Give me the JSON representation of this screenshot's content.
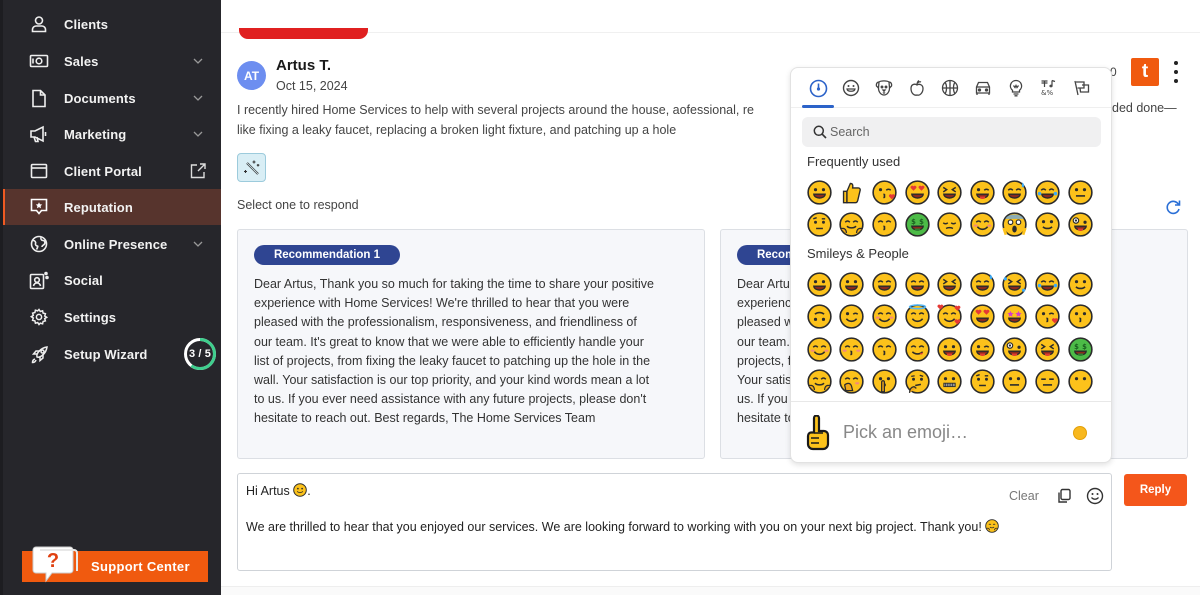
{
  "sidebar": {
    "items": [
      {
        "label": "Clients",
        "icon": "person-icon",
        "chevron": false
      },
      {
        "label": "Sales",
        "icon": "cash-icon",
        "chevron": true
      },
      {
        "label": "Documents",
        "icon": "document-icon",
        "chevron": true
      },
      {
        "label": "Marketing",
        "icon": "megaphone-icon",
        "chevron": true
      },
      {
        "label": "Client Portal",
        "icon": "browser-window-icon",
        "external": true
      },
      {
        "label": "Reputation",
        "icon": "star-chat-icon",
        "active": true
      },
      {
        "label": "Online Presence",
        "icon": "globe-icon",
        "chevron": true
      },
      {
        "label": "Social",
        "icon": "social-icon",
        "chevron": false
      },
      {
        "label": "Settings",
        "icon": "gear-icon",
        "chevron": false
      },
      {
        "label": "Setup Wizard",
        "icon": "rocket-icon",
        "progress_label": "3 / 5",
        "progress": 0.6
      }
    ],
    "support_label": "Support Center"
  },
  "review": {
    "avatar_initials": "AT",
    "author": "Artus T.",
    "date": "Oct 15, 2024",
    "text_line1": "I recently hired Home Services to help with several projects around the house, a",
    "text_line1_b": "ofessional, re",
    "text_line1_tail": "ded done—",
    "text_line2": "like fixing a leaky faucet, replacing a broken light fixture, and patching up a hole",
    "score_partial": "0",
    "brand_letter": "t"
  },
  "respond": {
    "select_label": "Select one to respond",
    "recommendations": [
      {
        "badge": "Recommendation 1",
        "lines": [
          "Dear Artus, Thank you so much for taking the time to share your positive",
          "experience with Home Services! We're thrilled to hear that you were",
          "pleased with the professionalism, responsiveness, and friendliness of",
          "our team. It's great to know that we were able to efficiently handle your",
          "list of projects, from fixing the leaky faucet to patching up the hole in the",
          "wall. Your satisfaction is our top priority, and your kind words mean a lot",
          "to us. If you ever need assistance with any future projects, please don't",
          "hesitate to reach out. Best regards, The Home Services Team"
        ]
      },
      {
        "badge": "Recommendation 2",
        "lines": [
          "Dear Artus, Thank you so much for sharing your positive",
          "experience with Home Services! We're thrilled that you were",
          "pleased with our professionalism and friendliness of",
          "our team. We're glad we could handle your list of",
          "projects, from the leaky faucet to patching the hole in the wall.",
          "Your satisfaction matters, and your kind words mean a lot to",
          "us. If you need help with future projects, please don't",
          "hesitate to reach out."
        ]
      }
    ]
  },
  "reply": {
    "greeting": "Hi Artus",
    "greeting_suffix": ".",
    "body": "We are thrilled to hear that you enjoyed our services. We are looking forward to working with you on your next big project. Thank you!",
    "clear_label": "Clear",
    "reply_label": "Reply"
  },
  "emoji_picker": {
    "categories": [
      "recent-clock-icon",
      "smiley-icon",
      "dog-icon",
      "apple-icon",
      "basketball-icon",
      "car-icon",
      "lightbulb-icon",
      "symbols-icon",
      "flags-icon"
    ],
    "active_category": 0,
    "search_placeholder": "Search",
    "frequently_used_title": "Frequently used",
    "smileys_title": "Smileys & People",
    "frequently_used": [
      "grinning",
      "thumbs-up",
      "kiss-heart",
      "heart-eyes",
      "squint-laugh",
      "wink-tongue",
      "sweat-smile",
      "joy",
      "neutral"
    ],
    "frequently_used_row2": [
      "raised-brow",
      "hugging",
      "kissing-closed",
      "money-mouth",
      "pensive",
      "blush",
      "scream",
      "slight-smile",
      "zany"
    ],
    "smileys": [
      [
        "grinning",
        "smiley",
        "smile",
        "grin",
        "squint-laugh",
        "sweat-smile",
        "rofl",
        "joy",
        "slight-smile"
      ],
      [
        "upside-down",
        "wink",
        "blush",
        "innocent",
        "smiling-hearts",
        "heart-eyes",
        "star-struck",
        "kiss-heart",
        "kissing"
      ],
      [
        "relaxed",
        "kissing-smiling",
        "kissing-closed",
        "yum",
        "tongue",
        "wink-tongue",
        "zany",
        "squint-tongue",
        "money-mouth"
      ],
      [
        "hugging",
        "hand-over-mouth",
        "shushing",
        "thinking",
        "zipper",
        "raised-brow",
        "neutral",
        "expressionless",
        "no-mouth"
      ]
    ],
    "footer_placeholder": "Pick an emoji…",
    "skin_tone_color": "#f8b81e"
  },
  "colors": {
    "accent_orange": "#f05a0f",
    "sidebar_bg": "#26262b",
    "active_nav_bg": "#57342d",
    "recommendation_badge": "#2f4592",
    "picker_accent": "#2c63c9"
  }
}
